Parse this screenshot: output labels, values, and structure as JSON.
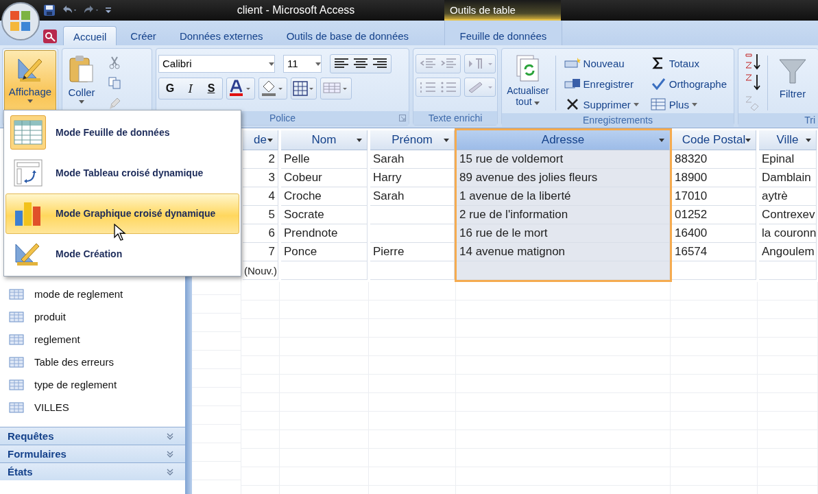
{
  "window": {
    "title": "client - Microsoft Access",
    "context_tab": "Outils de table"
  },
  "tabs": [
    {
      "label": "Accueil",
      "selected": true,
      "contextual": false
    },
    {
      "label": "Créer",
      "selected": false,
      "contextual": false
    },
    {
      "label": "Données externes",
      "selected": false,
      "contextual": false
    },
    {
      "label": "Outils de base de données",
      "selected": false,
      "contextual": false
    },
    {
      "label": "Feuille de données",
      "selected": false,
      "contextual": true
    }
  ],
  "ribbon": {
    "view": {
      "label": "Affichage",
      "pressed": true
    },
    "clipboard": {
      "paste": "Coller"
    },
    "font": {
      "name": "Calibri",
      "size": "11",
      "bold": "G",
      "italic": "I",
      "underline": "S",
      "label": "Police"
    },
    "rich_text": {
      "label": "Texte enrichi"
    },
    "records": {
      "refresh": "Actualiser tout",
      "label": "Enregistrements",
      "commands": [
        {
          "kind": "new",
          "label": "Nouveau",
          "dropdown": false
        },
        {
          "kind": "save",
          "label": "Enregistrer",
          "dropdown": false
        },
        {
          "kind": "delete",
          "label": "Supprimer",
          "dropdown": true
        },
        {
          "kind": "totals",
          "label": "Totaux",
          "dropdown": false
        },
        {
          "kind": "spelling",
          "label": "Orthographe",
          "dropdown": false
        },
        {
          "kind": "more",
          "label": "Plus",
          "dropdown": true
        }
      ]
    },
    "sort": {
      "filter": "Filtrer",
      "label": "Tri"
    }
  },
  "view_menu": {
    "items": [
      {
        "kind": "datasheet",
        "label": "Mode Feuille de données",
        "current": true,
        "selected": false
      },
      {
        "kind": "pivot_table",
        "label": "Mode Tableau croisé dynamique",
        "current": false,
        "selected": false
      },
      {
        "kind": "pivot_chart",
        "label": "Mode Graphique croisé dynamique",
        "current": false,
        "selected": true
      },
      {
        "kind": "design",
        "label": "Mode Création",
        "current": false,
        "selected": false
      }
    ]
  },
  "nav": {
    "items": [
      "mode de reglement",
      "produit",
      "reglement",
      "Table des erreurs",
      "type de reglement",
      "VILLES"
    ],
    "sections": [
      "Requêtes",
      "Formulaires",
      "États"
    ]
  },
  "table": {
    "columns": [
      {
        "label": "de",
        "selected": false
      },
      {
        "label": "Nom",
        "selected": false
      },
      {
        "label": "Prénom",
        "selected": false
      },
      {
        "label": "Adresse",
        "selected": true
      },
      {
        "label": "Code Postal",
        "selected": false
      },
      {
        "label": "Ville",
        "selected": false
      }
    ],
    "rows": [
      {
        "cells": [
          "2",
          "Pelle",
          "Sarah",
          "15 rue de voldemort",
          "88320",
          "Epinal"
        ]
      },
      {
        "cells": [
          "3",
          "Cobeur",
          "Harry",
          "89 avenue des jolies fleurs",
          "18900",
          "Damblain"
        ]
      },
      {
        "cells": [
          "4",
          "Croche",
          "Sarah",
          "1 avenue de la liberté",
          "17010",
          "aytrè"
        ]
      },
      {
        "cells": [
          "5",
          "Socrate",
          "",
          "2 rue de l'information",
          "01252",
          "Contrexev"
        ]
      },
      {
        "cells": [
          "6",
          "Prendnote",
          "",
          "16 rue de le mort",
          "16400",
          "la couronn"
        ]
      },
      {
        "cells": [
          "7",
          "Ponce",
          "Pierre",
          "14 avenue matignon",
          "16574",
          "Angoulem"
        ]
      }
    ],
    "new_row": "(Nouv.)"
  }
}
